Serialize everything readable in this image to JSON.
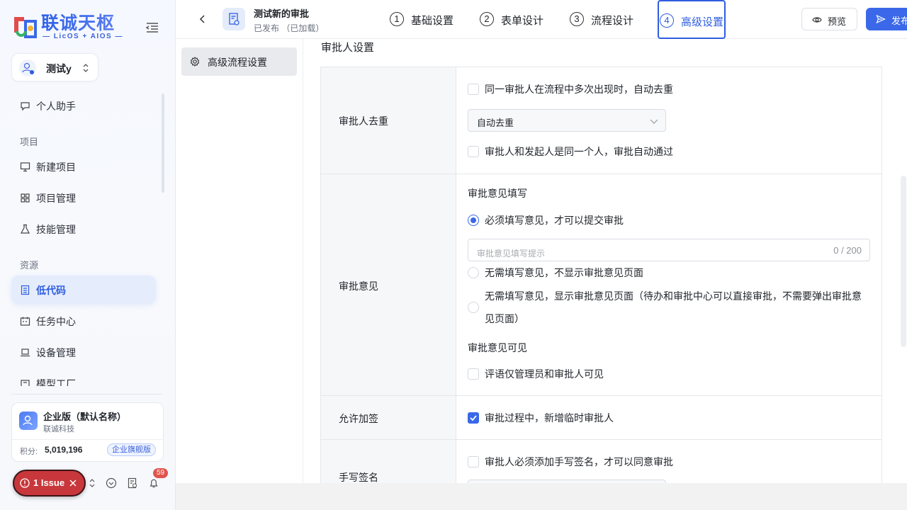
{
  "brand": {
    "name": "联诚天枢",
    "sub": "— LicOS + AIOS —"
  },
  "tenant": {
    "name": "测试y"
  },
  "nav": {
    "assistant": "个人助手",
    "section_project": "项目",
    "new_project": "新建项目",
    "project_mgmt": "项目管理",
    "skill_mgmt": "技能管理",
    "section_resource": "资源",
    "lowcode": "低代码",
    "task_center": "任务中心",
    "device_mgmt": "设备管理",
    "model_factory": "模型工厂"
  },
  "org": {
    "name": "企业版（默认名称）",
    "company": "联诚科技",
    "points_label": "积分:",
    "points": "5,019,196",
    "badge": "企业旗舰版"
  },
  "issue": {
    "label": "1 Issue"
  },
  "notifications": {
    "count": "59"
  },
  "header": {
    "title": "测试新的审批",
    "status": "已发布  （已加载）",
    "steps": [
      {
        "num": "1",
        "label": "基础设置"
      },
      {
        "num": "2",
        "label": "表单设计"
      },
      {
        "num": "3",
        "label": "流程设计"
      },
      {
        "num": "4",
        "label": "高级设置"
      }
    ],
    "preview": "预览",
    "publish": "发布"
  },
  "left_panel": {
    "item": "高级流程设置"
  },
  "main": {
    "section_title": "审批人设置",
    "rows": {
      "dedup": {
        "label": "审批人去重",
        "opt1": "同一审批人在流程中多次出现时，自动去重",
        "select_value": "自动去重",
        "opt2": "审批人和发起人是同一个人，审批自动通过"
      },
      "opinion": {
        "label": "审批意见",
        "fill_title": "审批意见填写",
        "opt_required": "必须填写意见，才可以提交审批",
        "placeholder": "审批意见填写提示",
        "counter": "0 / 200",
        "opt_none_hidden": "无需填写意见，不显示审批意见页面",
        "opt_none_shown_1": "无需填写意见，显示审批意见页面（待办和审批中心可以直接审批，不需要弹出审批意",
        "opt_none_shown_2": "见页面）",
        "visible_title": "审批意见可见",
        "opt_visible": "评语仅管理员和审批人可见"
      },
      "addsign": {
        "label": "允许加签",
        "opt": "审批过程中，新增临时审批人"
      },
      "signature": {
        "label": "手写签名",
        "opt": "审批人必须添加手写签名，才可以同意审批"
      }
    }
  },
  "colors": {
    "accent": "#3a68e8",
    "issue": "#c8373b"
  }
}
